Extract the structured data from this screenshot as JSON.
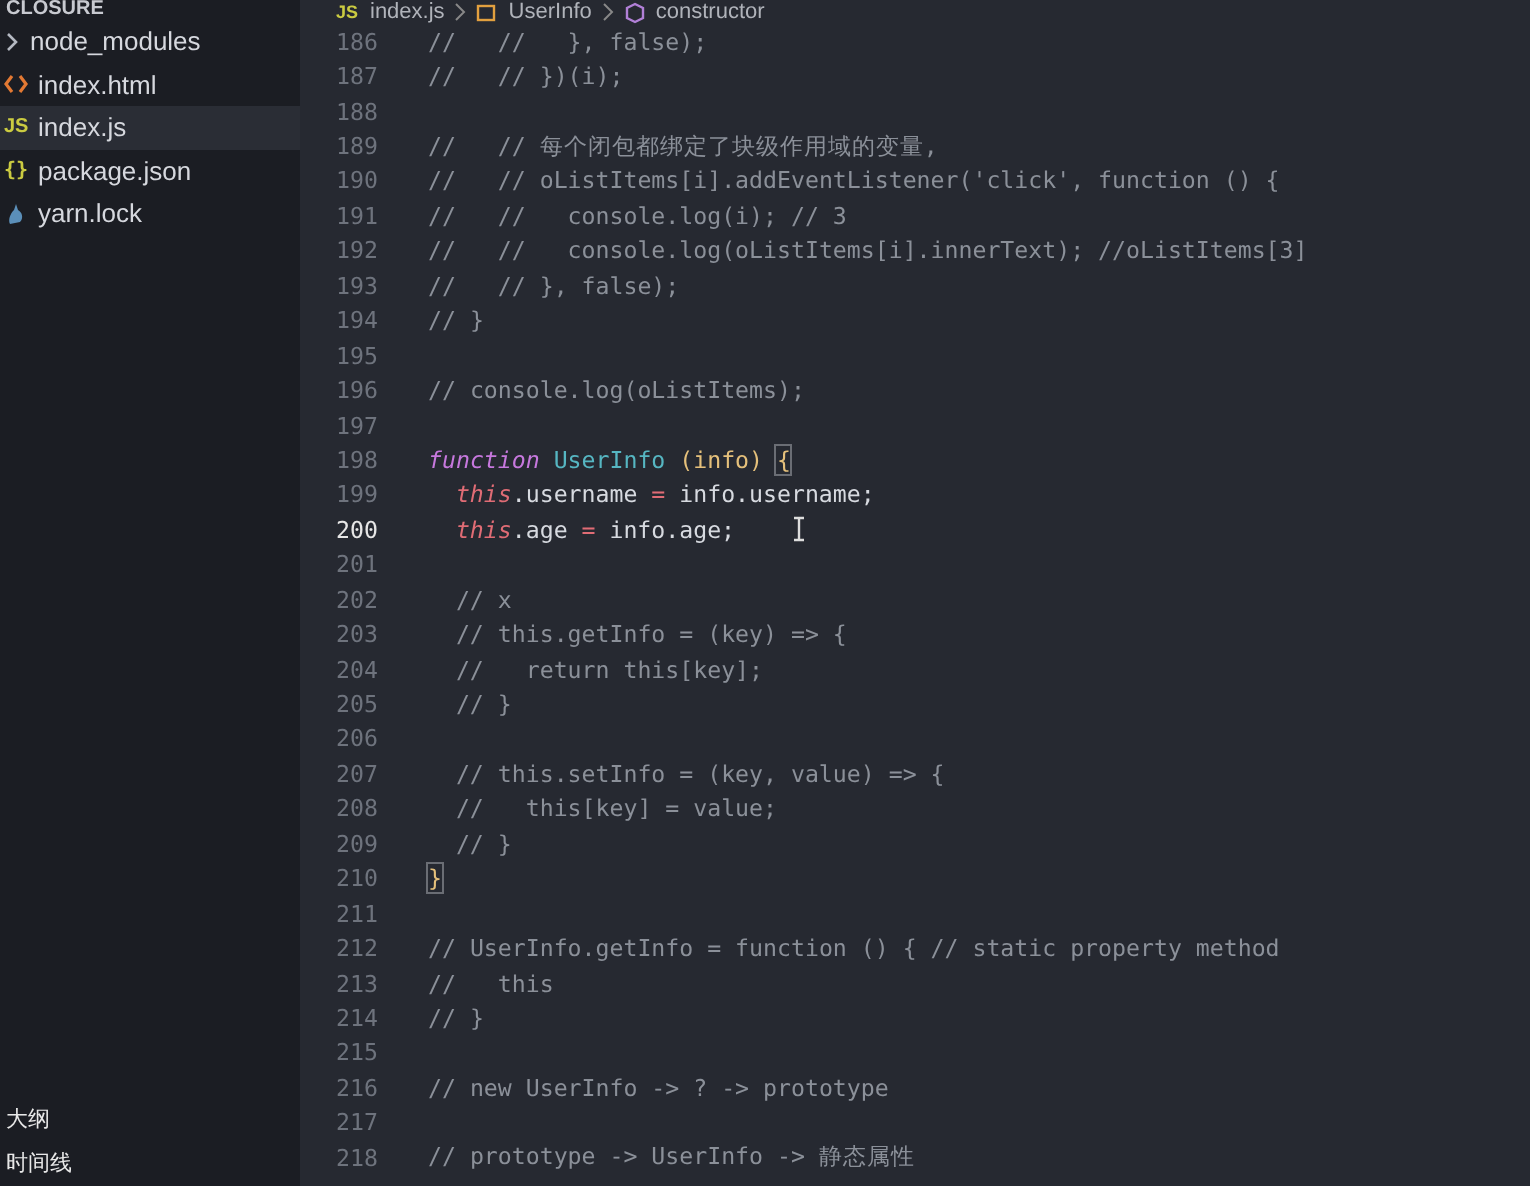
{
  "sidebar": {
    "section": "CLOSURE",
    "files": [
      {
        "name": "node_modules",
        "kind": "folder",
        "selected": false
      },
      {
        "name": "index.html",
        "kind": "html",
        "selected": false
      },
      {
        "name": "index.js",
        "kind": "js",
        "icon_text": "JS",
        "selected": true
      },
      {
        "name": "package.json",
        "kind": "json",
        "icon_text": "{}",
        "selected": false
      },
      {
        "name": "yarn.lock",
        "kind": "yarn",
        "selected": false
      }
    ],
    "panels": [
      "大纲",
      "时间线"
    ]
  },
  "breadcrumb": [
    {
      "text": "index.js",
      "icon_text": "JS",
      "kind": "file"
    },
    {
      "text": "UserInfo",
      "kind": "class"
    },
    {
      "text": "constructor",
      "kind": "method"
    }
  ],
  "lines": [
    {
      "number": "186",
      "current": false,
      "tokens": [
        {
          "kind": "comment",
          "text": "//   //   }, false);"
        }
      ]
    },
    {
      "number": "187",
      "current": false,
      "tokens": [
        {
          "kind": "comment",
          "text": "//   // })(i);"
        }
      ]
    },
    {
      "number": "188",
      "current": false
    },
    {
      "number": "189",
      "current": false,
      "tokens": [
        {
          "kind": "comment",
          "text": "//   // 每个闭包都绑定了块级作用域的变量,"
        }
      ]
    },
    {
      "number": "190",
      "current": false,
      "tokens": [
        {
          "kind": "comment",
          "text": "//   // oListItems[i].addEventListener('click', function () {"
        }
      ]
    },
    {
      "number": "191",
      "current": false,
      "tokens": [
        {
          "kind": "comment",
          "text": "//   //   console.log(i); // 3"
        }
      ]
    },
    {
      "number": "192",
      "current": false,
      "tokens": [
        {
          "kind": "comment",
          "text": "//   //   console.log(oListItems[i].innerText); //oListItems[3]"
        }
      ]
    },
    {
      "number": "193",
      "current": false,
      "tokens": [
        {
          "kind": "comment",
          "text": "//   // }, false);"
        }
      ]
    },
    {
      "number": "194",
      "current": false,
      "tokens": [
        {
          "kind": "comment",
          "text": "// }"
        }
      ]
    },
    {
      "number": "195",
      "current": false
    },
    {
      "number": "196",
      "current": false,
      "tokens": [
        {
          "kind": "comment",
          "text": "// console.log(oListItems);"
        }
      ]
    },
    {
      "number": "197",
      "current": false
    },
    {
      "number": "198",
      "current": false,
      "tokens": [
        {
          "kind": "keyword",
          "text": "function"
        },
        {
          "kind": "function",
          "text": "UserInfo",
          "space_before": true
        },
        {
          "kind": "param",
          "text": "(info)",
          "space_before": true
        },
        {
          "kind": "bracket",
          "text": "{",
          "space_before": true
        }
      ]
    },
    {
      "number": "199",
      "current": false,
      "indent": true,
      "tokens": [
        {
          "kind": "this",
          "text": "this"
        },
        {
          "kind": "plain",
          "text": ".username"
        },
        {
          "kind": "operator",
          "text": "=",
          "space_before": true
        },
        {
          "kind": "plain",
          "text": "info.username;",
          "space_before": true
        }
      ]
    },
    {
      "number": "200",
      "current": true,
      "indent": true,
      "cursor": true,
      "tokens": [
        {
          "kind": "this",
          "text": "this"
        },
        {
          "kind": "plain",
          "text": ".age"
        },
        {
          "kind": "operator",
          "text": "=",
          "space_before": true
        },
        {
          "kind": "plain",
          "text": "info.age;",
          "space_before": true
        }
      ]
    },
    {
      "number": "201",
      "current": false
    },
    {
      "number": "202",
      "current": false,
      "indent": true,
      "tokens": [
        {
          "kind": "comment",
          "text": "// x"
        }
      ]
    },
    {
      "number": "203",
      "current": false,
      "indent": true,
      "tokens": [
        {
          "kind": "comment",
          "text": "// this.getInfo = (key) => {"
        }
      ]
    },
    {
      "number": "204",
      "current": false,
      "indent": true,
      "tokens": [
        {
          "kind": "comment",
          "text": "//   return this[key];"
        }
      ]
    },
    {
      "number": "205",
      "current": false,
      "indent": true,
      "tokens": [
        {
          "kind": "comment",
          "text": "// }"
        }
      ]
    },
    {
      "number": "206",
      "current": false
    },
    {
      "number": "207",
      "current": false,
      "indent": true,
      "tokens": [
        {
          "kind": "comment",
          "text": "// this.setInfo = (key, value) => {"
        }
      ]
    },
    {
      "number": "208",
      "current": false,
      "indent": true,
      "tokens": [
        {
          "kind": "comment",
          "text": "//   this[key] = value;"
        }
      ]
    },
    {
      "number": "209",
      "current": false,
      "indent": true,
      "tokens": [
        {
          "kind": "comment",
          "text": "// }"
        }
      ]
    },
    {
      "number": "210",
      "current": false,
      "tokens": [
        {
          "kind": "bracket",
          "text": "}"
        }
      ]
    },
    {
      "number": "211",
      "current": false
    },
    {
      "number": "212",
      "current": false,
      "tokens": [
        {
          "kind": "comment",
          "text": "// UserInfo.getInfo = function () { // static property method"
        }
      ]
    },
    {
      "number": "213",
      "current": false,
      "tokens": [
        {
          "kind": "comment",
          "text": "//   this"
        }
      ]
    },
    {
      "number": "214",
      "current": false,
      "tokens": [
        {
          "kind": "comment",
          "text": "// }"
        }
      ]
    },
    {
      "number": "215",
      "current": false
    },
    {
      "number": "216",
      "current": false,
      "tokens": [
        {
          "kind": "comment",
          "text": "// new UserInfo -> ? -> prototype"
        }
      ]
    },
    {
      "number": "217",
      "current": false
    },
    {
      "number": "218",
      "current": false,
      "tokens": [
        {
          "kind": "comment",
          "text": "// prototype -> UserInfo -> 静态属性"
        }
      ]
    }
  ]
}
